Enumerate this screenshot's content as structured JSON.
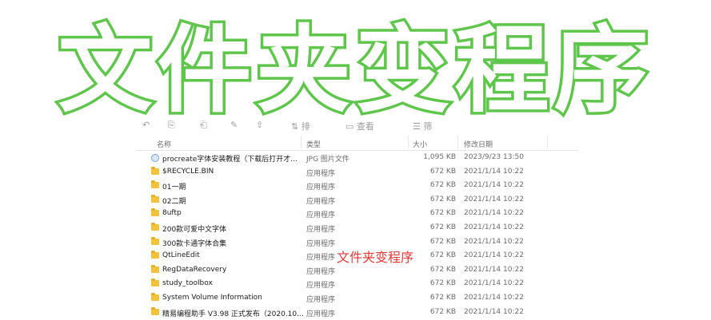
{
  "banner": {
    "title": "文件夹变程序"
  },
  "toolbar": {
    "items": [
      "排",
      "查看",
      "筛"
    ]
  },
  "table": {
    "headers": {
      "name": "名称",
      "type": "类型",
      "size": "大小",
      "date": "修改日期"
    },
    "rows": [
      {
        "name": "procreate字体安装教程（下载后打开才...",
        "type": "JPG 图片文件",
        "size": "1,095 KB",
        "date": "2023/9/23 13:50",
        "icon": "image-file-icon"
      },
      {
        "name": "$RECYCLE.BIN",
        "type": "应用程序",
        "size": "672 KB",
        "date": "2021/1/14 10:22",
        "icon": "folder-icon"
      },
      {
        "name": "01一期",
        "type": "应用程序",
        "size": "672 KB",
        "date": "2021/1/14 10:22",
        "icon": "folder-icon"
      },
      {
        "name": "02二期",
        "type": "应用程序",
        "size": "672 KB",
        "date": "2021/1/14 10:22",
        "icon": "folder-icon"
      },
      {
        "name": "8uftp",
        "type": "应用程序",
        "size": "672 KB",
        "date": "2021/1/14 10:22",
        "icon": "folder-icon"
      },
      {
        "name": "200款可爱中文字体",
        "type": "应用程序",
        "size": "672 KB",
        "date": "2021/1/14 10:22",
        "icon": "folder-icon"
      },
      {
        "name": "300款卡通字体合集",
        "type": "应用程序",
        "size": "672 KB",
        "date": "2021/1/14 10:22",
        "icon": "folder-icon"
      },
      {
        "name": "QtLineEdit",
        "type": "应用程序",
        "size": "672 KB",
        "date": "2021/1/14 10:22",
        "icon": "folder-icon"
      },
      {
        "name": "RegDataRecovery",
        "type": "应用程序",
        "size": "672 KB",
        "date": "2021/1/14 10:22",
        "icon": "folder-icon"
      },
      {
        "name": "study_toolbox",
        "type": "应用程序",
        "size": "672 KB",
        "date": "2021/1/14 10:22",
        "icon": "folder-icon"
      },
      {
        "name": "System Volume Information",
        "type": "应用程序",
        "size": "672 KB",
        "date": "2021/1/14 10:22",
        "icon": "folder-icon"
      },
      {
        "name": "精易编程助手 V3.98 正式发布（2020.10...",
        "type": "应用程序",
        "size": "672 KB",
        "date": "2021/1/14 10:22",
        "icon": "folder-icon"
      }
    ]
  },
  "watermark": "文件夹变程序",
  "colors": {
    "banner_stroke": "#5ec64a",
    "watermark": "#e53935",
    "folder": "#f3c13a"
  }
}
